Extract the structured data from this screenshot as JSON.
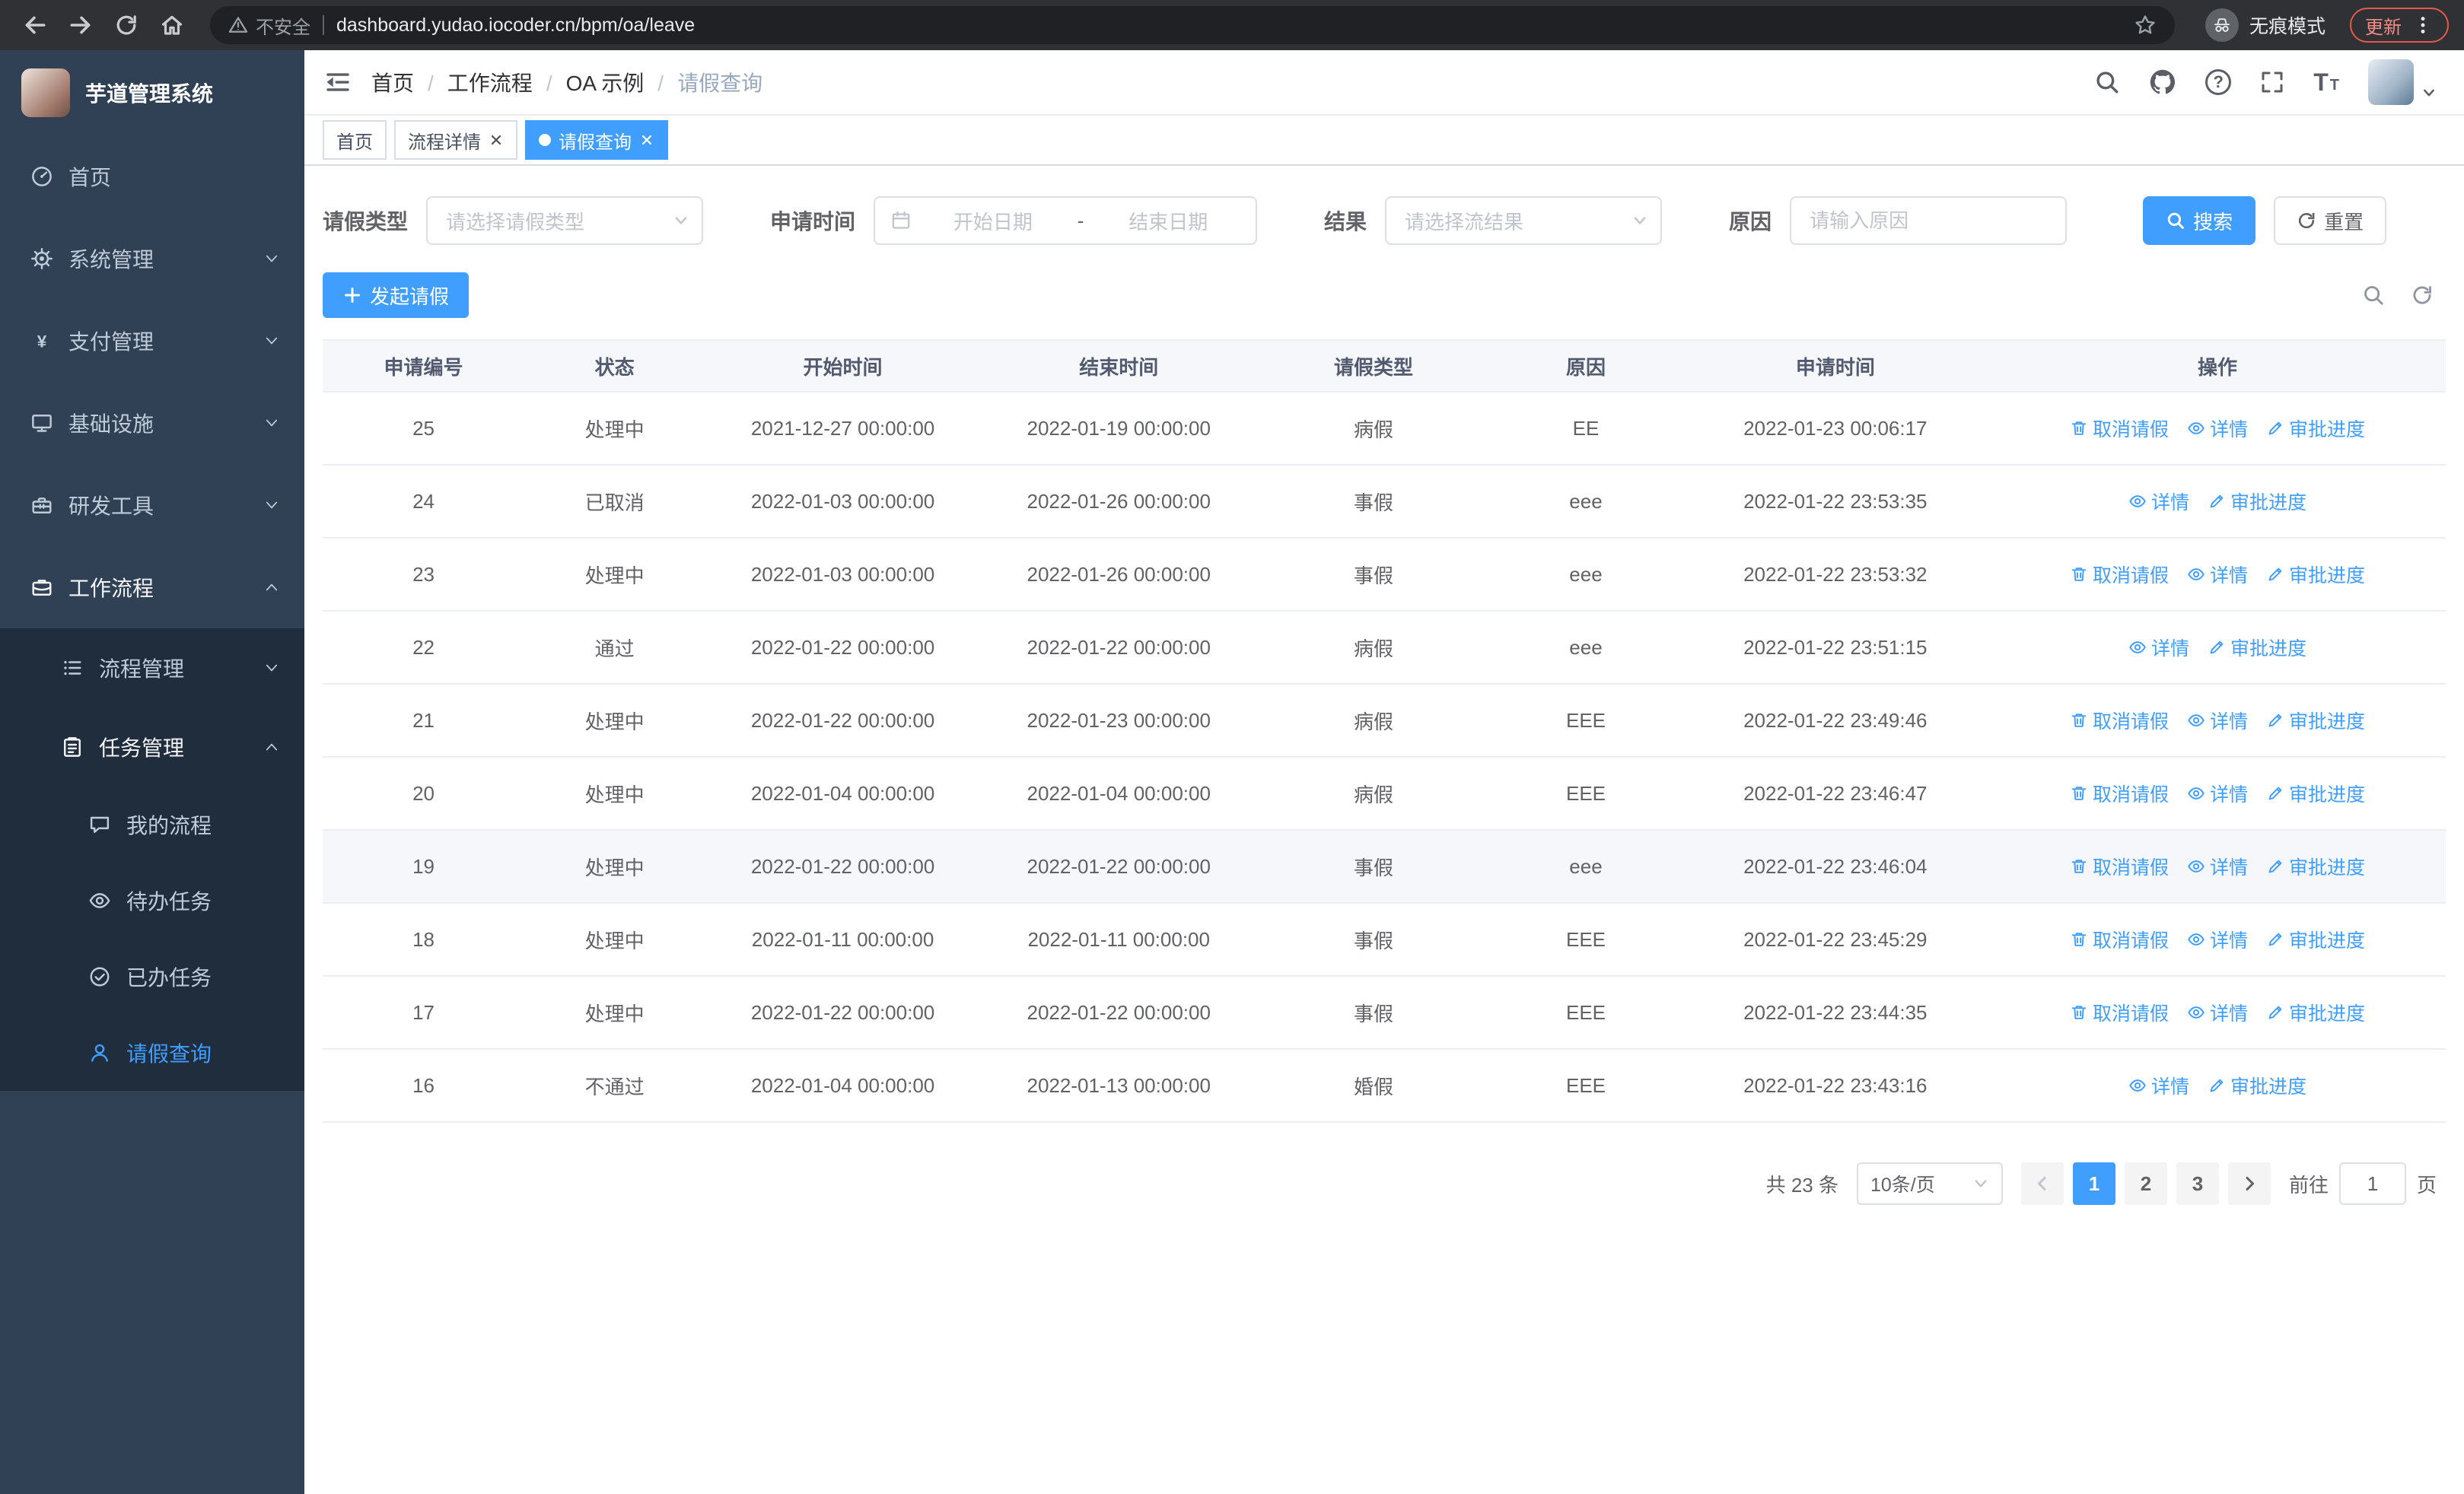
{
  "browser": {
    "security_label": "不安全",
    "url": "dashboard.yudao.iocoder.cn/bpm/oa/leave",
    "incognito_label": "无痕模式",
    "update_label": "更新"
  },
  "sidebar": {
    "logo_title": "芋道管理系统",
    "items": [
      {
        "id": "home",
        "label": "首页",
        "icon": "dashboard",
        "depth": 0
      },
      {
        "id": "system-mgmt",
        "label": "系统管理",
        "icon": "gear",
        "depth": 0,
        "chevron": "down"
      },
      {
        "id": "payment-mgmt",
        "label": "支付管理",
        "icon": "yen",
        "depth": 0,
        "chevron": "down"
      },
      {
        "id": "infrastructure",
        "label": "基础设施",
        "icon": "monitor",
        "depth": 0,
        "chevron": "down"
      },
      {
        "id": "dev-tools",
        "label": "研发工具",
        "icon": "toolbox",
        "depth": 0,
        "chevron": "down"
      },
      {
        "id": "workflow",
        "label": "工作流程",
        "icon": "briefcase",
        "depth": 0,
        "chevron": "up",
        "bright": true
      },
      {
        "id": "process-mgmt",
        "label": "流程管理",
        "icon": "list",
        "depth": 1,
        "chevron": "down"
      },
      {
        "id": "task-mgmt",
        "label": "任务管理",
        "icon": "clipboard",
        "depth": 1,
        "chevron": "up",
        "bright": true
      },
      {
        "id": "my-process",
        "label": "我的流程",
        "icon": "chat",
        "depth": 2
      },
      {
        "id": "todo-task",
        "label": "待办任务",
        "icon": "eye",
        "depth": 2
      },
      {
        "id": "done-task",
        "label": "已办任务",
        "icon": "check",
        "depth": 2
      },
      {
        "id": "leave-query",
        "label": "请假查询",
        "icon": "user",
        "depth": 2,
        "active": true
      }
    ]
  },
  "header": {
    "breadcrumb": [
      "首页",
      "工作流程",
      "OA 示例",
      "请假查询"
    ]
  },
  "tabs": [
    {
      "id": "home",
      "label": "首页",
      "closable": false,
      "active": false
    },
    {
      "id": "process-detail",
      "label": "流程详情",
      "closable": true,
      "active": false
    },
    {
      "id": "leave-query",
      "label": "请假查询",
      "closable": true,
      "active": true
    }
  ],
  "filters": {
    "leave_type_label": "请假类型",
    "leave_type_placeholder": "请选择请假类型",
    "apply_time_label": "申请时间",
    "start_date_placeholder": "开始日期",
    "range_separator": "-",
    "end_date_placeholder": "结束日期",
    "result_label": "结果",
    "result_placeholder": "请选择流结果",
    "reason_label": "原因",
    "reason_placeholder": "请输入原因",
    "search_button": "搜索",
    "reset_button": "重置"
  },
  "toolbar": {
    "create_button": "发起请假"
  },
  "table": {
    "columns": [
      "申请编号",
      "状态",
      "开始时间",
      "结束时间",
      "请假类型",
      "原因",
      "申请时间",
      "操作"
    ],
    "action_labels": {
      "cancel": "取消请假",
      "detail": "详情",
      "progress": "审批进度"
    },
    "rows": [
      {
        "id": "25",
        "status": "处理中",
        "start": "2021-12-27 00:00:00",
        "end": "2022-01-19 00:00:00",
        "type": "病假",
        "reason": "EE",
        "applied": "2022-01-23 00:06:17",
        "actions": [
          "cancel",
          "detail",
          "progress"
        ]
      },
      {
        "id": "24",
        "status": "已取消",
        "start": "2022-01-03 00:00:00",
        "end": "2022-01-26 00:00:00",
        "type": "事假",
        "reason": "eee",
        "applied": "2022-01-22 23:53:35",
        "actions": [
          "detail",
          "progress"
        ]
      },
      {
        "id": "23",
        "status": "处理中",
        "start": "2022-01-03 00:00:00",
        "end": "2022-01-26 00:00:00",
        "type": "事假",
        "reason": "eee",
        "applied": "2022-01-22 23:53:32",
        "actions": [
          "cancel",
          "detail",
          "progress"
        ]
      },
      {
        "id": "22",
        "status": "通过",
        "start": "2022-01-22 00:00:00",
        "end": "2022-01-22 00:00:00",
        "type": "病假",
        "reason": "eee",
        "applied": "2022-01-22 23:51:15",
        "actions": [
          "detail",
          "progress"
        ]
      },
      {
        "id": "21",
        "status": "处理中",
        "start": "2022-01-22 00:00:00",
        "end": "2022-01-23 00:00:00",
        "type": "病假",
        "reason": "EEE",
        "applied": "2022-01-22 23:49:46",
        "actions": [
          "cancel",
          "detail",
          "progress"
        ]
      },
      {
        "id": "20",
        "status": "处理中",
        "start": "2022-01-04 00:00:00",
        "end": "2022-01-04 00:00:00",
        "type": "病假",
        "reason": "EEE",
        "applied": "2022-01-22 23:46:47",
        "actions": [
          "cancel",
          "detail",
          "progress"
        ]
      },
      {
        "id": "19",
        "status": "处理中",
        "start": "2022-01-22 00:00:00",
        "end": "2022-01-22 00:00:00",
        "type": "事假",
        "reason": "eee",
        "applied": "2022-01-22 23:46:04",
        "actions": [
          "cancel",
          "detail",
          "progress"
        ],
        "highlighted": true
      },
      {
        "id": "18",
        "status": "处理中",
        "start": "2022-01-11 00:00:00",
        "end": "2022-01-11 00:00:00",
        "type": "事假",
        "reason": "EEE",
        "applied": "2022-01-22 23:45:29",
        "actions": [
          "cancel",
          "detail",
          "progress"
        ]
      },
      {
        "id": "17",
        "status": "处理中",
        "start": "2022-01-22 00:00:00",
        "end": "2022-01-22 00:00:00",
        "type": "事假",
        "reason": "EEE",
        "applied": "2022-01-22 23:44:35",
        "actions": [
          "cancel",
          "detail",
          "progress"
        ]
      },
      {
        "id": "16",
        "status": "不通过",
        "start": "2022-01-04 00:00:00",
        "end": "2022-01-13 00:00:00",
        "type": "婚假",
        "reason": "EEE",
        "applied": "2022-01-22 23:43:16",
        "actions": [
          "detail",
          "progress"
        ]
      }
    ]
  },
  "pagination": {
    "total_text": "共 23 条",
    "page_size": "10条/页",
    "pages": [
      "1",
      "2",
      "3"
    ],
    "active_page": "1",
    "goto_label": "前往",
    "goto_value": "1",
    "goto_suffix": "页"
  },
  "colors": {
    "primary": "#409eff",
    "sidebar_bg": "#304156",
    "submenu_bg": "#1f2d3d"
  }
}
